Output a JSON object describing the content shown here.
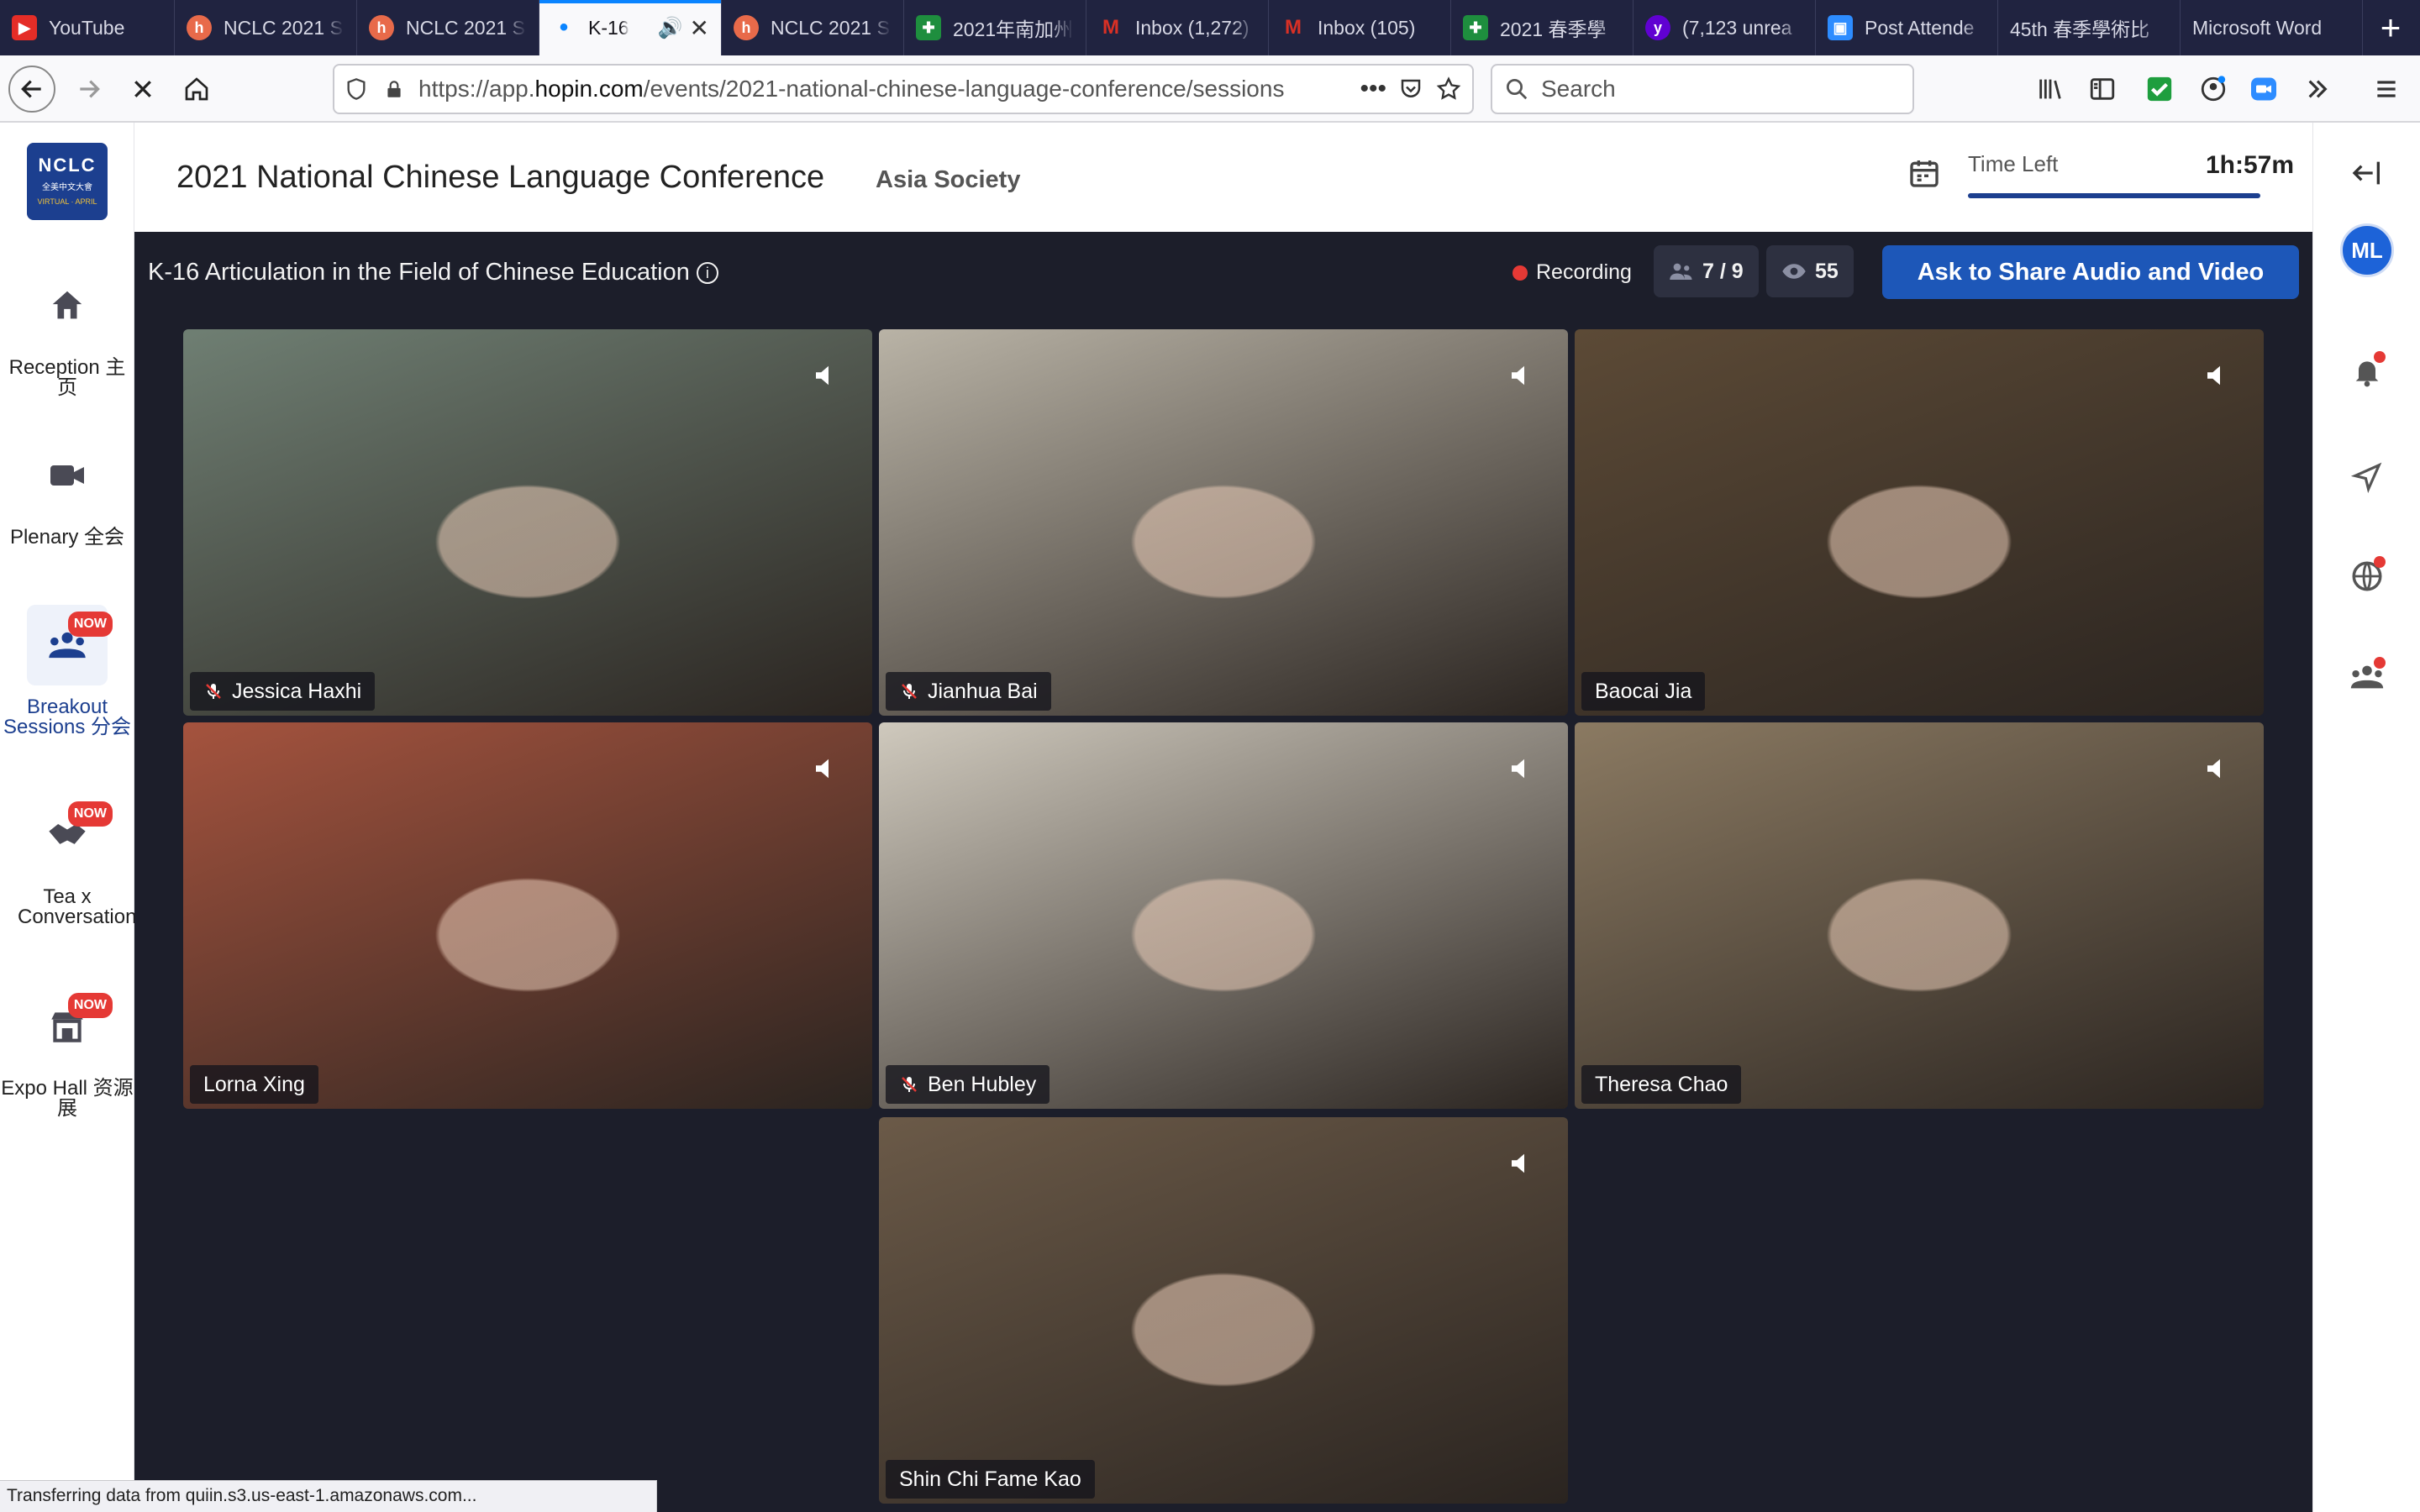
{
  "browser": {
    "tabs": [
      {
        "label": "YouTube",
        "icon": "youtube-icon",
        "color": "#e52d27",
        "active": false
      },
      {
        "label": "NCLC 2021 S",
        "icon": "hopin-icon",
        "color": "#e86a4a",
        "active": false
      },
      {
        "label": "NCLC 2021 S",
        "icon": "hopin-icon",
        "color": "#e86a4a",
        "active": false
      },
      {
        "label": "K-16",
        "icon": "loading-icon",
        "color": "#0a84ff",
        "active": true
      },
      {
        "label": "NCLC 2021 S",
        "icon": "hopin-icon",
        "color": "#e86a4a",
        "active": false
      },
      {
        "label": "2021年南加州",
        "icon": "sheets-icon",
        "color": "#1e8e3e",
        "active": false
      },
      {
        "label": "Inbox (1,272)",
        "icon": "gmail-icon",
        "color": "#d93025",
        "active": false
      },
      {
        "label": "Inbox (105)",
        "icon": "gmail-icon",
        "color": "#d93025",
        "active": false
      },
      {
        "label": "2021 春季學",
        "icon": "sheets-icon",
        "color": "#1e8e3e",
        "active": false
      },
      {
        "label": "(7,123 unrea",
        "icon": "yahoo-icon",
        "color": "#6001d2",
        "active": false
      },
      {
        "label": "Post Attende",
        "icon": "zoom-icon",
        "color": "#2d8cff",
        "active": false
      },
      {
        "label": "45th 春季學術比",
        "icon": "",
        "color": "",
        "active": false
      },
      {
        "label": "Microsoft Word",
        "icon": "",
        "color": "",
        "active": false
      }
    ],
    "url": {
      "prefix": "https://app.",
      "host": "hopin.com",
      "path": "/events/2021-national-chinese-language-conference/sessions"
    },
    "search_placeholder": "Search",
    "status_text": "Transferring data from quiin.s3.us-east-1.amazonaws.com..."
  },
  "sidebar": {
    "logo": {
      "line1": "NCLC",
      "line2": "全美中文大會",
      "line3": "VIRTUAL · APRIL"
    },
    "items": [
      {
        "label": "Reception 主页",
        "icon": "home-icon",
        "badge": "",
        "active": false
      },
      {
        "label": "Plenary 全会",
        "icon": "video-camera-icon",
        "badge": "",
        "active": false
      },
      {
        "label": "Breakout Sessions 分会",
        "icon": "people-group-icon",
        "badge": "NOW",
        "active": true
      },
      {
        "label": "Tea x Conversation",
        "icon": "handshake-icon",
        "badge": "NOW",
        "active": false
      },
      {
        "label": "Expo Hall 资源展",
        "icon": "booth-icon",
        "badge": "NOW",
        "active": false
      }
    ]
  },
  "event": {
    "title": "2021 National Chinese Language Conference",
    "organizer": "Asia Society",
    "time_left_label": "Time Left",
    "time_left_value": "1h:57m"
  },
  "session": {
    "title": "K-16 Articulation in the Field of Chinese Education",
    "recording_label": "Recording",
    "participants": "7 / 9",
    "viewers": "55",
    "share_button": "Ask to Share Audio and Video"
  },
  "videos": [
    {
      "name": "Jessica Haxhi",
      "muted": true,
      "bg": "#6f7f73"
    },
    {
      "name": "Jianhua Bai",
      "muted": true,
      "bg": "#b9b3a6"
    },
    {
      "name": "Baocai Jia",
      "muted": false,
      "bg": "#5c4a36"
    },
    {
      "name": "Lorna Xing",
      "muted": false,
      "bg": "#a5533e"
    },
    {
      "name": "Ben Hubley",
      "muted": true,
      "bg": "#cfc9bd"
    },
    {
      "name": "Theresa Chao",
      "muted": false,
      "bg": "#8b7a62"
    },
    {
      "name": "Shin Chi Fame Kao",
      "muted": false,
      "bg": "#6b5a48"
    }
  ],
  "right_rail": {
    "avatar_initials": "ML"
  },
  "colors": {
    "accent": "#1c3f8f",
    "stage": "#1c1e2a",
    "share_button": "#1d57b8",
    "record": "#e53935"
  }
}
